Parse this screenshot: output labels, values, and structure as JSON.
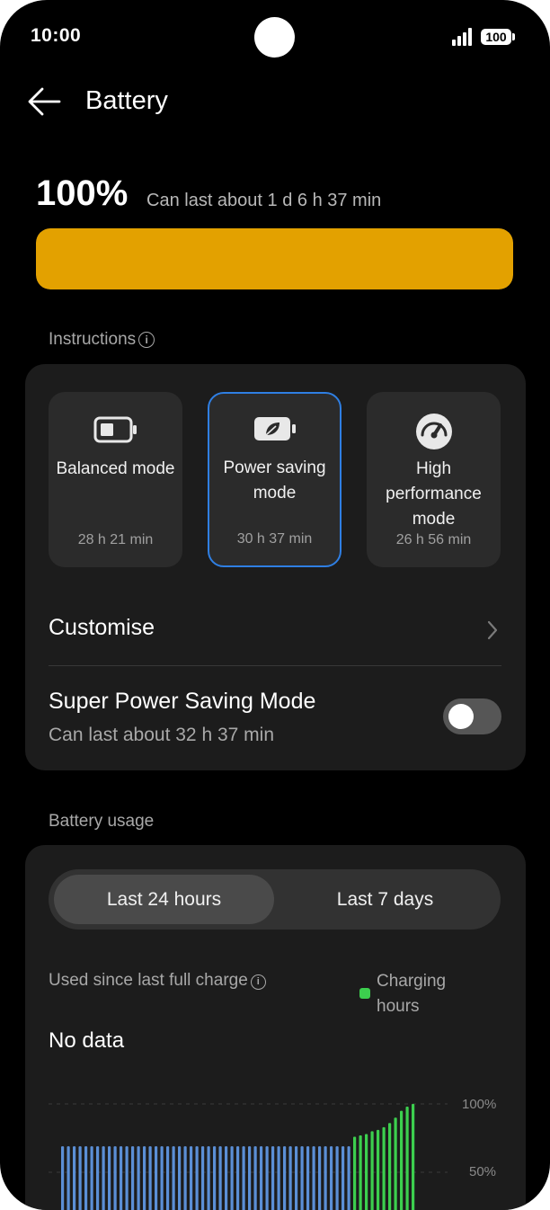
{
  "status_bar": {
    "time": "10:00",
    "battery_level": "100"
  },
  "header": {
    "title": "Battery"
  },
  "battery": {
    "percent_text": "100%",
    "level_percent": 100,
    "estimate_text": "Can last about 1 d 6 h 37 min",
    "bar_color": "#e3a100"
  },
  "instructions": {
    "label": "Instructions",
    "modes": [
      {
        "name": "Balanced mode",
        "time": "28 h 21 min",
        "icon": "battery-icon",
        "selected": false
      },
      {
        "name": "Power saving mode",
        "time": "30 h 37 min",
        "icon": "leaf-battery-icon",
        "selected": true
      },
      {
        "name": "High performance mode",
        "time": "26 h 56 min",
        "icon": "speedometer-icon",
        "selected": false
      }
    ],
    "customise_label": "Customise",
    "super_saving": {
      "title": "Super Power Saving Mode",
      "subtitle": "Can last about 32 h 37 min",
      "enabled": false
    }
  },
  "usage": {
    "label": "Battery usage",
    "tabs": [
      {
        "label": "Last 24 hours",
        "active": true
      },
      {
        "label": "Last 7 days",
        "active": false
      }
    ],
    "used_since_label": "Used since last full charge",
    "legend_label": "Charging hours",
    "no_data_label": "No data",
    "accent_color": "#2f7fe3",
    "charging_color": "#3ccf4e"
  },
  "chart_data": {
    "type": "bar",
    "y_tick_labels": [
      "100%",
      "50%"
    ],
    "ylim": [
      0,
      100
    ],
    "grid": true,
    "series": [
      {
        "name": "Charging hours",
        "color": "#3ccf4e",
        "values": [
          76,
          77,
          78,
          80,
          81,
          83,
          86,
          90,
          95,
          98,
          100
        ]
      }
    ],
    "battery_levels": [
      69,
      69,
      69,
      69,
      69,
      69,
      69,
      69,
      69,
      69,
      69,
      69,
      69,
      69,
      69,
      69,
      69,
      69,
      69,
      69,
      69,
      69,
      69,
      69,
      69,
      69,
      69,
      69,
      69,
      69,
      69,
      69,
      69,
      69,
      69,
      69,
      69,
      69,
      69,
      69,
      69,
      69,
      69,
      69,
      69,
      69,
      69,
      69,
      69,
      69,
      69,
      69,
      69,
      69,
      69,
      69,
      69,
      69,
      69,
      69,
      69,
      69,
      69,
      69,
      69,
      69,
      69,
      69,
      69,
      69,
      69,
      69,
      69,
      69,
      69,
      69,
      69,
      69,
      69,
      69,
      69,
      69,
      69,
      69,
      69,
      69,
      69,
      69,
      69,
      69,
      69,
      69,
      69,
      69,
      69,
      69,
      69,
      69,
      69,
      69
    ]
  }
}
